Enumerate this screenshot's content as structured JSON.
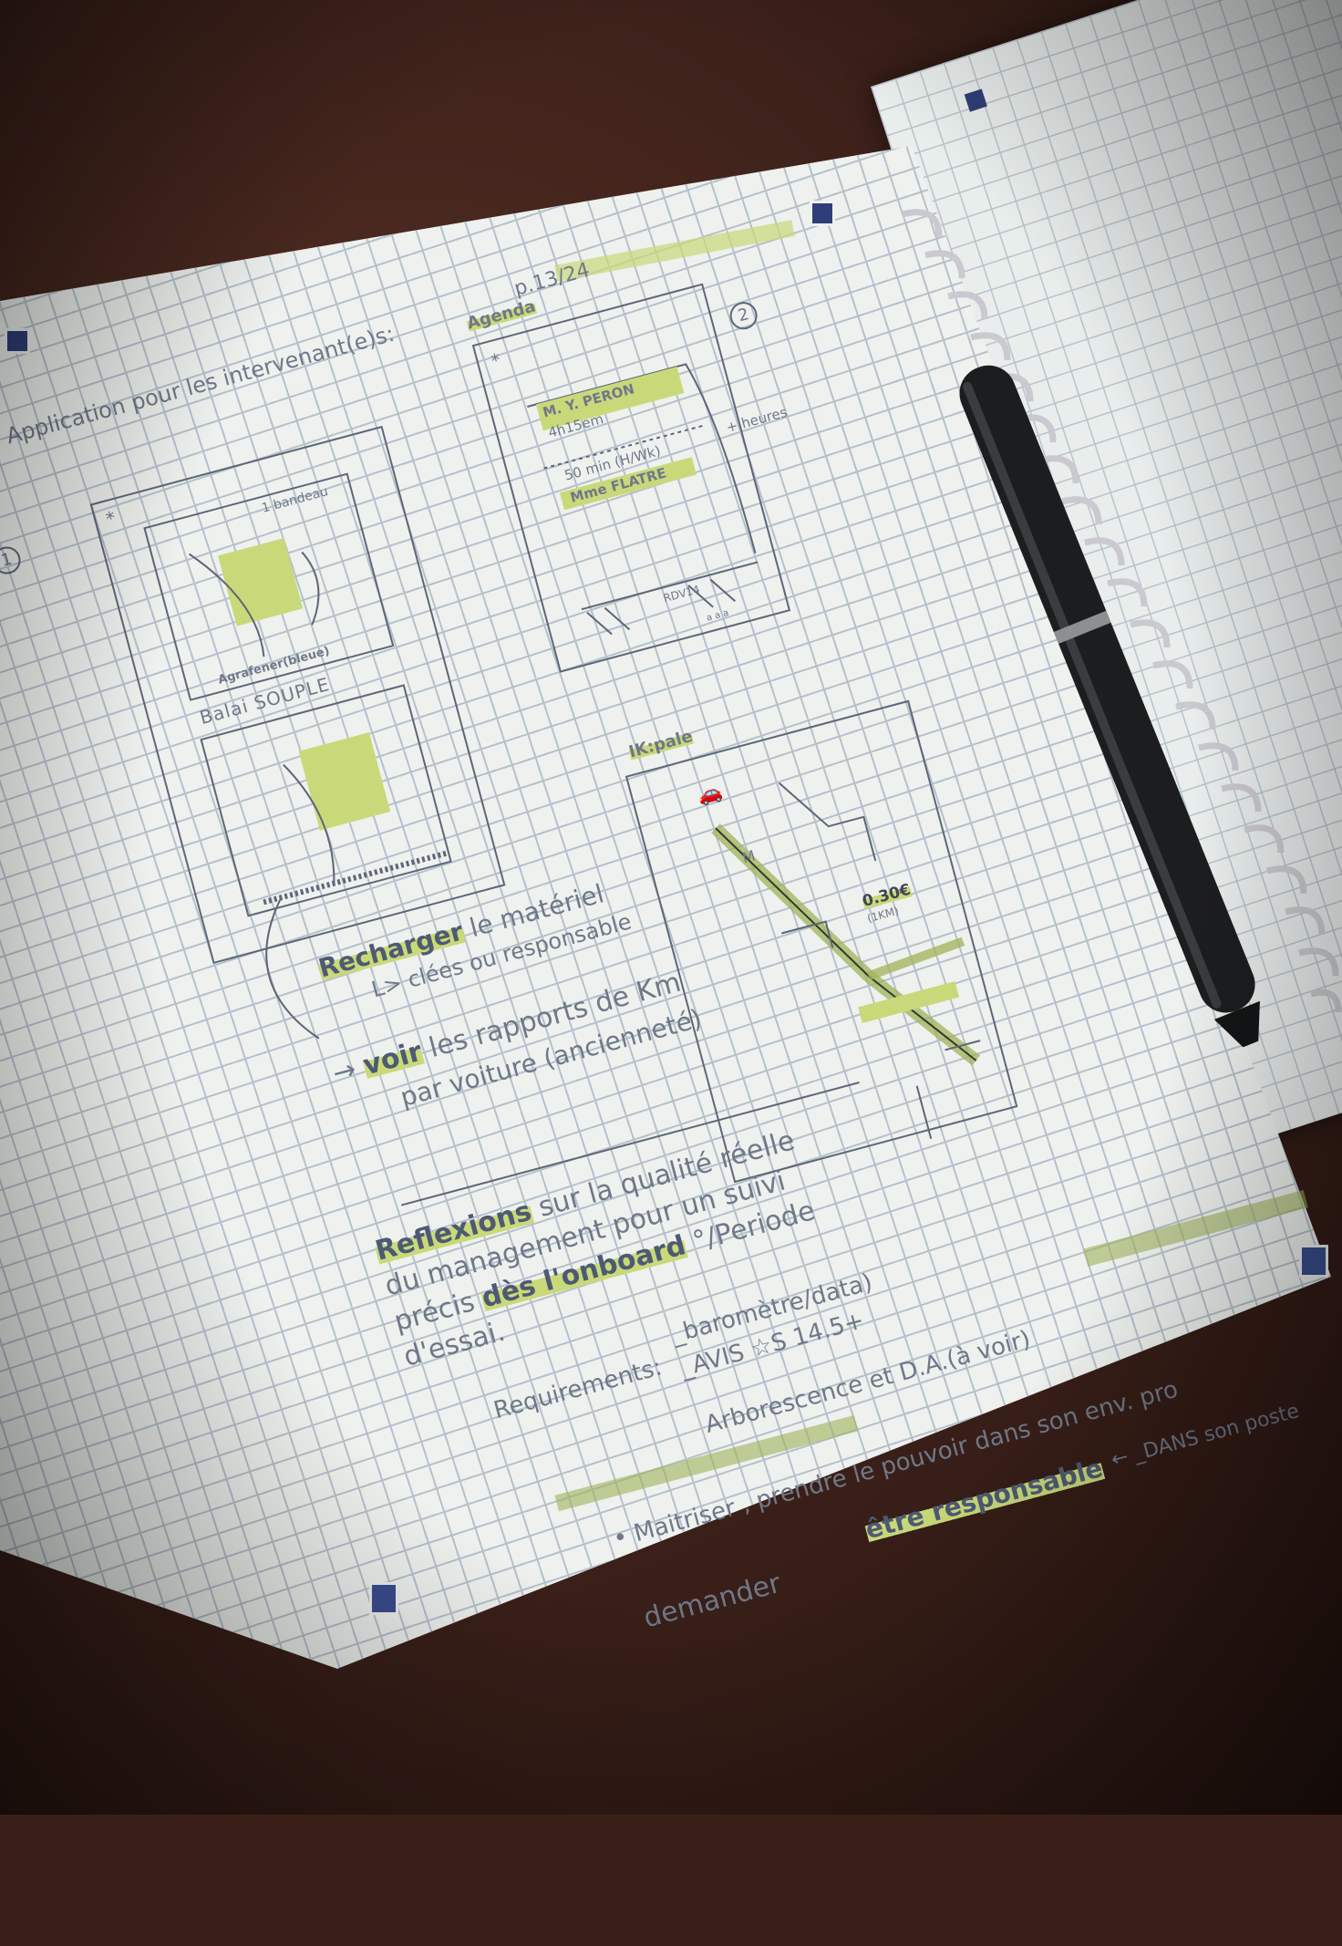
{
  "notebook_left": {
    "header_highlight": "p.13/24",
    "title": "Application pour les intervenant(e)s:",
    "circle_1": "1",
    "circle_2": "2",
    "sketch1": {
      "star": "*",
      "label_top": "1 bandeau",
      "label_bottom": "Agrafener(bleue)",
      "caption": "Balai SOUPLE"
    },
    "agenda": {
      "heading": "Agenda",
      "star": "*",
      "entry1_name": "M. Y. PERON",
      "entry1_time": "4h15em",
      "entry2_time": "50 min (H/Wk)",
      "entry2_note": "+ heures",
      "entry3_name": "Mme FLATRE",
      "footer": "RDV14",
      "dots": "a a a"
    },
    "ik_map": {
      "heading": "IK:pale",
      "marker_car": "car",
      "price": "0.30€",
      "price_unit": "(1KM)",
      "letter_m": "M"
    },
    "notes": {
      "recharger_keyword": "Recharger",
      "recharger_rest": "le matériel",
      "recharger_sub": "L> clées ou responsable",
      "voir_keyword": "voir",
      "voir_rest": "les rapports de Km",
      "voir_sub": "par voiture (ancienneté)",
      "reflexions_keyword": "Reflexions",
      "reflexions_rest": "sur la qualité réelle",
      "reflexions_line2": "du management pour un suivi",
      "reflexions_line3_a": "précis",
      "reflexions_line3_b": "dès l'onboard",
      "reflexions_line3_c": "°/Periode",
      "reflexions_line4": "d'essai.",
      "requirements_label": "Requirements:",
      "requirements_item1": "_baromètre/data)",
      "requirements_item2": "_AVIS ☆S 14.5+",
      "arborescence": "Arborescence et D.A.(à voir)",
      "maitriser": "• Maitriser , prendre le pouvoir dans son env. pro",
      "etre_responsable": "être responsable",
      "dans_son_poste": "← _DANS son poste",
      "demander": "demander"
    }
  },
  "colors": {
    "paper": "#eef1ee",
    "grid": "#b5c1cc",
    "ink": "#6f7888",
    "highlight": "#c9d97a",
    "pen_body": "#1c1d1f",
    "spiral": "#c9c9cf",
    "table": "#4a2a20"
  },
  "icons": [
    "corner-logo-icon",
    "pen-icon",
    "spiral-binding-icon",
    "car-icon",
    "hand-sketch-icon",
    "glove-sketch-icon",
    "star-icon"
  ]
}
